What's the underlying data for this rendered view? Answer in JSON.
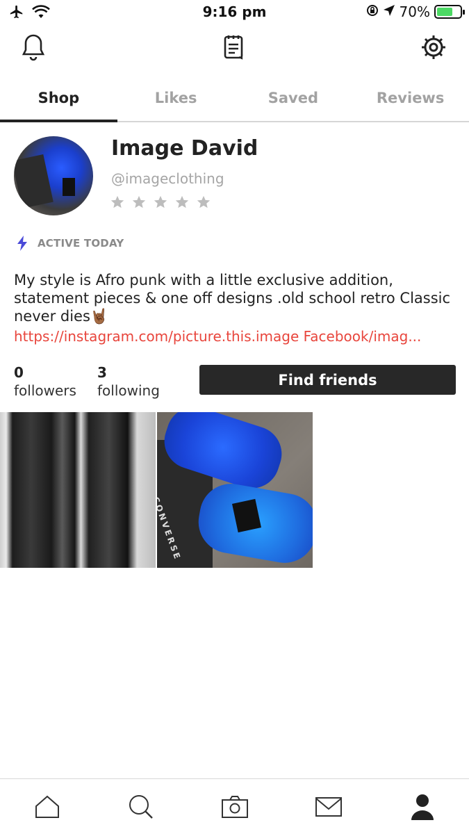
{
  "status_bar": {
    "time": "9:16 pm",
    "battery": "70%"
  },
  "tabs": [
    {
      "label": "Shop",
      "active": true
    },
    {
      "label": "Likes",
      "active": false
    },
    {
      "label": "Saved",
      "active": false
    },
    {
      "label": "Reviews",
      "active": false
    }
  ],
  "profile": {
    "name": "Image David",
    "handle": "@imageclothing",
    "rating_stars": 5,
    "rating_filled": 0,
    "activity": "ACTIVE TODAY",
    "bio": "My style is Afro punk with a little exclusive addition, statement pieces & one off designs .old school retro Classic never dies🤘🏾",
    "links": "https://instagram.com/picture.this.image  Facebook/imag...",
    "followers_count": "0",
    "followers_label": "followers",
    "following_count": "3",
    "following_label": "following",
    "find_friends_label": "Find friends"
  },
  "listings": [
    {
      "icon": "boots-photo"
    },
    {
      "icon": "converse-shoes-photo",
      "brand_text": "CONVERSE"
    }
  ],
  "colors": {
    "link": "#e8453c",
    "button_bg": "#282828",
    "active_icon": "#4a4ad8",
    "battery_fill": "#4cd964"
  },
  "bottom_nav": [
    "home-icon",
    "search-icon",
    "camera-icon",
    "mail-icon",
    "profile-icon"
  ]
}
